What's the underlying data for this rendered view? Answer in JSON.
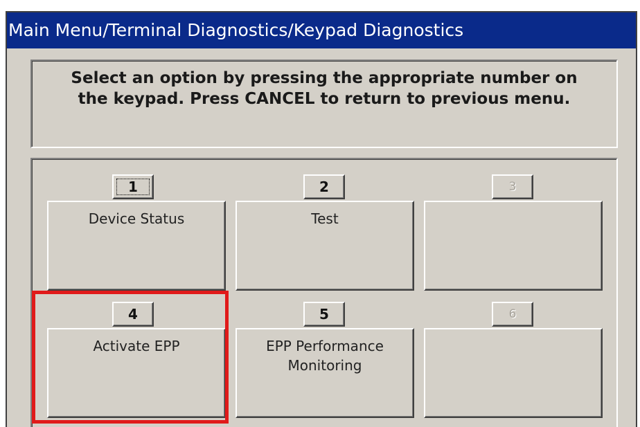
{
  "window": {
    "title": "Main Menu/Terminal Diagnostics/Keypad Diagnostics"
  },
  "instructions": {
    "text": "Select an option by pressing the appropriate number on\nthe keypad.  Press CANCEL to return to previous menu."
  },
  "options": [
    {
      "number": "1",
      "label": "Device Status",
      "enabled": true,
      "focused": true
    },
    {
      "number": "2",
      "label": "Test",
      "enabled": true,
      "focused": false
    },
    {
      "number": "3",
      "label": "",
      "enabled": false,
      "focused": false
    },
    {
      "number": "4",
      "label": "Activate EPP",
      "enabled": true,
      "focused": false,
      "highlighted": true
    },
    {
      "number": "5",
      "label": "EPP Performance\nMonitoring",
      "enabled": true,
      "focused": false
    },
    {
      "number": "6",
      "label": "",
      "enabled": false,
      "focused": false
    }
  ],
  "colors": {
    "title_bar": "#0a2a8a",
    "face": "#d4d0c8",
    "highlight_box": "#e01a1a"
  }
}
